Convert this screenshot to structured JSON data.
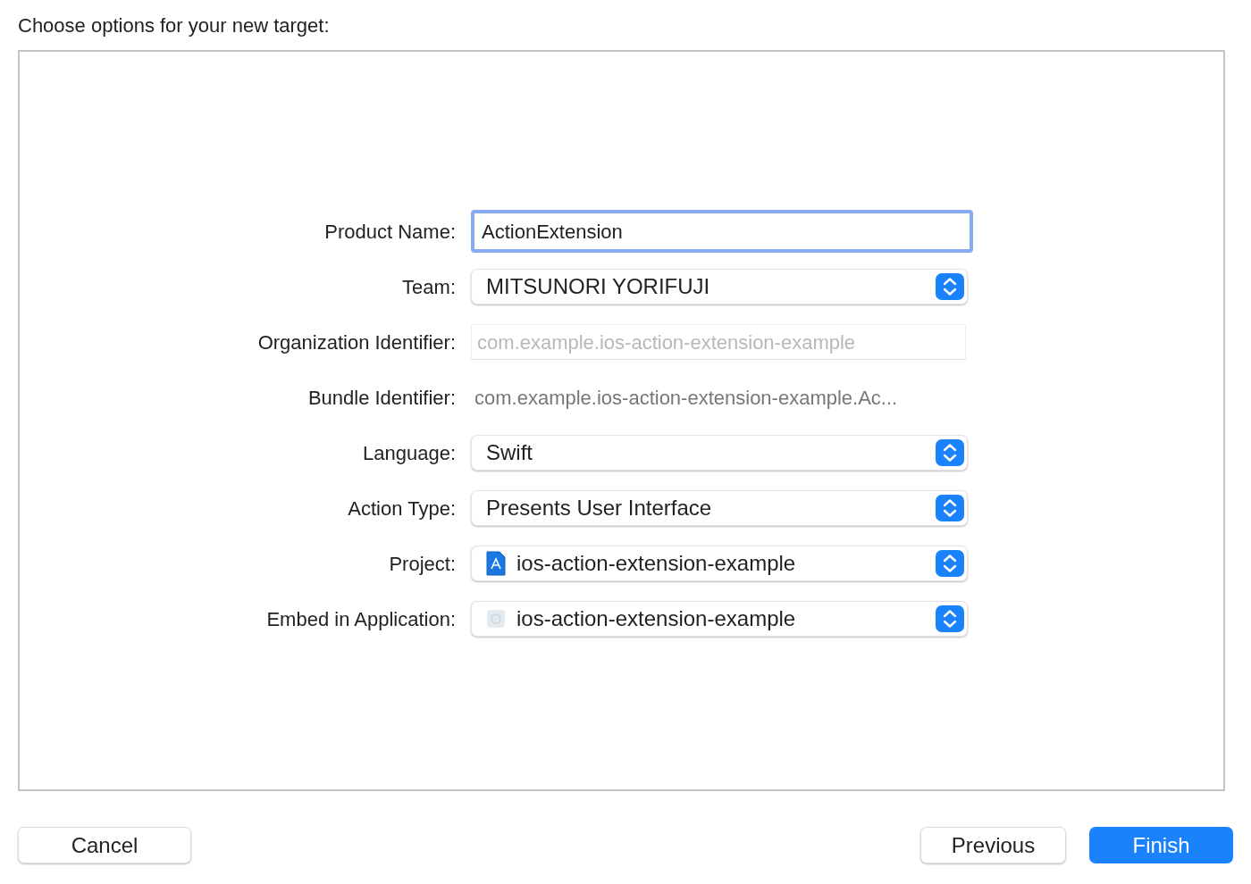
{
  "heading": "Choose options for your new target:",
  "fields": [
    {
      "kind": "text_field",
      "label": "Product Name:",
      "value": "ActionExtension",
      "focused": true
    },
    {
      "kind": "popup",
      "label": "Team:",
      "value": "MITSUNORI YORIFUJI"
    },
    {
      "kind": "disabled_field",
      "label": "Organization Identifier:",
      "value": "com.example.ios-action-extension-example"
    },
    {
      "kind": "static",
      "label": "Bundle Identifier:",
      "value": "com.example.ios-action-extension-example.Ac..."
    },
    {
      "kind": "popup",
      "label": "Language:",
      "value": "Swift"
    },
    {
      "kind": "popup",
      "label": "Action Type:",
      "value": "Presents User Interface"
    },
    {
      "kind": "project_popup",
      "label": "Project:",
      "value": "ios-action-extension-example"
    },
    {
      "kind": "app_popup",
      "label": "Embed in Application:",
      "value": "ios-action-extension-example"
    }
  ],
  "buttons": [
    {
      "label": "Cancel",
      "primary": false
    },
    {
      "label": "Previous",
      "primary": false
    },
    {
      "label": "Finish",
      "primary": true
    }
  ]
}
